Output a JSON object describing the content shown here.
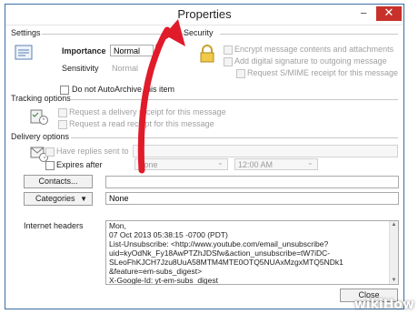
{
  "window": {
    "title": "Properties",
    "minimize_glyph": "−",
    "close_glyph": "✕"
  },
  "settings": {
    "section_label": "Settings",
    "importance_label": "Importance",
    "importance_value": "Normal",
    "sensitivity_label": "Sensitivity",
    "sensitivity_value": "Normal",
    "no_autoarchive_label": "Do not AutoArchive this item"
  },
  "security": {
    "section_label": "Security",
    "encrypt_label": "Encrypt message contents and attachments",
    "signature_label": "Add digital signature to outgoing message",
    "smime_label": "Request S/MIME receipt for this message"
  },
  "tracking": {
    "section_label": "Tracking options",
    "delivery_receipt_label": "Request a delivery receipt for this message",
    "read_receipt_label": "Request a read receipt for this message"
  },
  "delivery": {
    "section_label": "Delivery options",
    "replies_label": "Have replies sent to",
    "expires_label": "Expires after",
    "expires_date": "None",
    "expires_time": "12:00 AM"
  },
  "contacts_button": "Contacts...",
  "categories_button": "Categories",
  "categories_value": "None",
  "internet_headers": {
    "label": "Internet headers",
    "lines": [
      "Mon,",
      " 07 Oct 2013 05:38:15 -0700 (PDT)",
      "List-Unsubscribe: <http://www.youtube.com/email_unsubscribe?",
      "uid=kyOdNk_Fy18AwPTZhJDSfw&action_unsubscribe=tW7iDC-",
      "SLeoFhKJCH7Jzu8UuA58MTM4MTE0OTQ5NUAxMzgxMTQ5NDk1",
      "&feature=em-subs_digest>",
      "X-Google-Id: yt-em-subs_digest"
    ]
  },
  "close_button": "Close",
  "watermark": "wikiHow",
  "colors": {
    "arrow": "#e01b2a",
    "title_border": "#3a6ea5",
    "close": "#c8312a"
  }
}
